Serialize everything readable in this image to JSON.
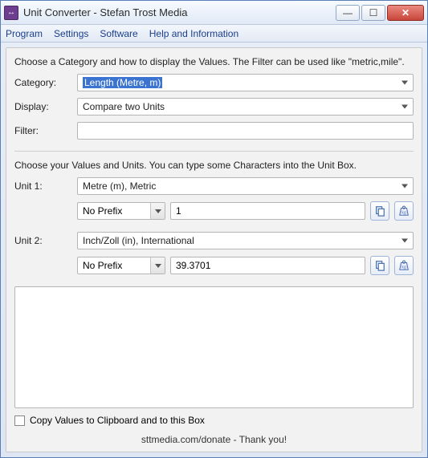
{
  "window": {
    "title": "Unit Converter - Stefan Trost Media"
  },
  "menu": {
    "program": "Program",
    "settings": "Settings",
    "software": "Software",
    "help": "Help and Information"
  },
  "section1": {
    "intro": "Choose a Category and how to display the Values. The Filter can be used like \"metric,mile\".",
    "category_label": "Category:",
    "category_value": "Length (Metre, m)",
    "display_label": "Display:",
    "display_value": "Compare two Units",
    "filter_label": "Filter:",
    "filter_value": ""
  },
  "section2": {
    "intro": "Choose your Values and Units. You can type some Characters into the Unit Box.",
    "unit1_label": "Unit 1:",
    "unit1_value": "Metre (m), Metric",
    "unit1_prefix": "No Prefix",
    "unit1_amount": "1",
    "unit2_label": "Unit 2:",
    "unit2_value": "Inch/Zoll (in), International",
    "unit2_prefix": "No Prefix",
    "unit2_amount": "39.3701"
  },
  "copy_checkbox_label": "Copy Values to Clipboard and to this Box",
  "footer_text": "sttmedia.com/donate - Thank you!",
  "icons": {
    "copy": "copy",
    "weight": "kg"
  }
}
